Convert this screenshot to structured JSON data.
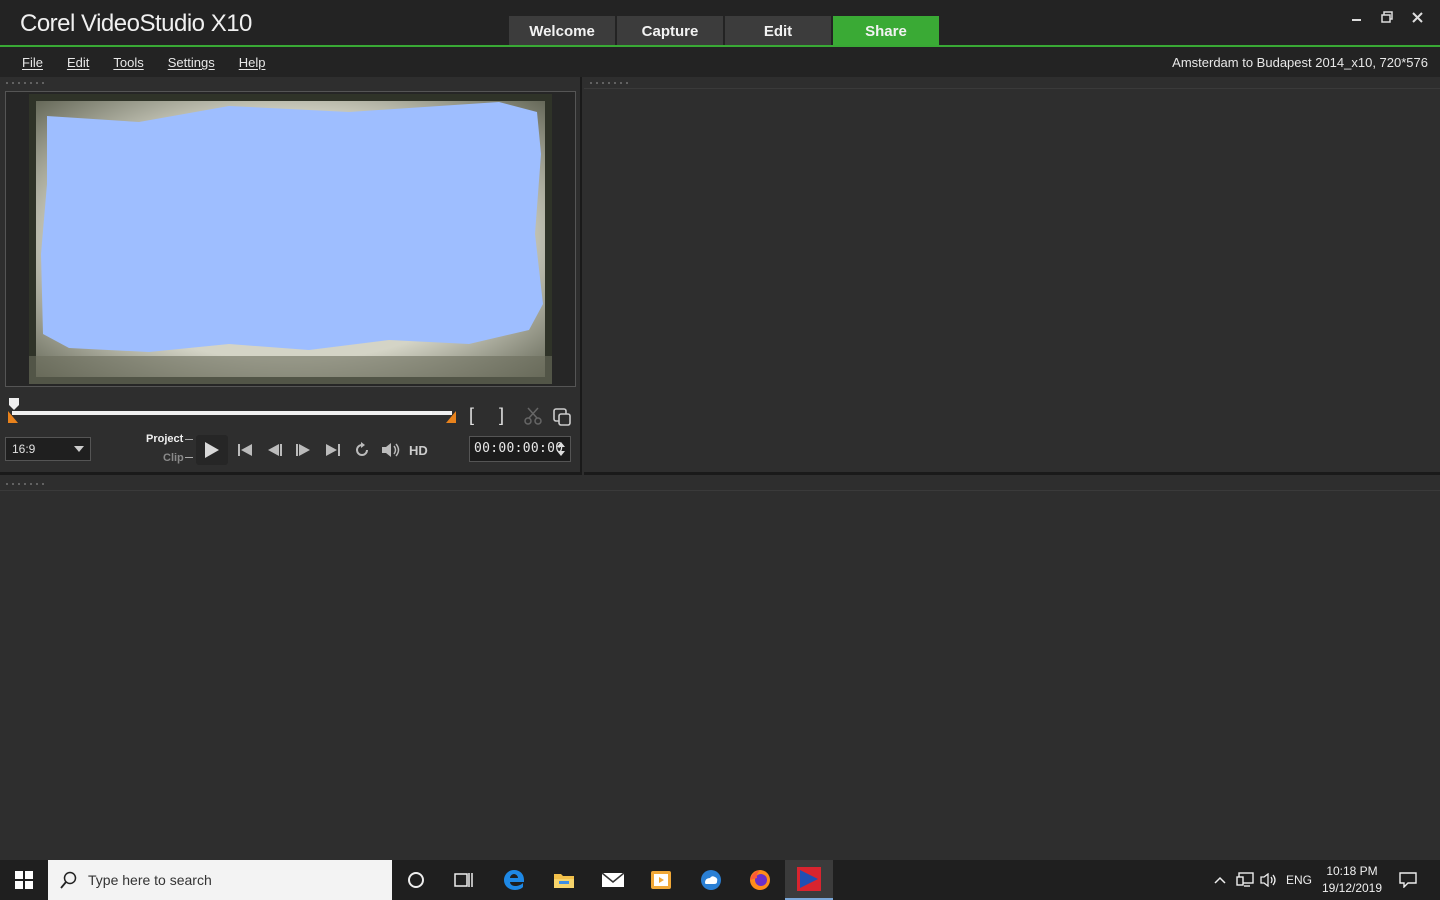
{
  "app": {
    "title": "Corel VideoStudio X10",
    "project_info": "Amsterdam to Budapest 2014_x10, 720*576"
  },
  "tabs": [
    {
      "label": "Welcome",
      "active": false
    },
    {
      "label": "Capture",
      "active": false
    },
    {
      "label": "Edit",
      "active": false
    },
    {
      "label": "Share",
      "active": true
    }
  ],
  "window_controls": {
    "minimize": "minimize-icon",
    "restore": "restore-icon",
    "close": "close-icon"
  },
  "menu": [
    "File",
    "Edit",
    "Tools",
    "Settings",
    "Help"
  ],
  "player": {
    "aspect_ratio": "16:9",
    "mode_project": "Project",
    "mode_clip": "Clip",
    "hd_label": "HD",
    "timecode": "00:00:00:00",
    "mark_in": "[",
    "mark_out": "]",
    "scrub_position": 0.0
  },
  "taskbar": {
    "search_placeholder": "Type here to search",
    "language": "ENG",
    "time": "10:18 PM",
    "date": "19/12/2019"
  },
  "colors": {
    "accent_green": "#3aaa35",
    "preview_blue": "#9ebeff",
    "trim_orange": "#e8821c"
  }
}
